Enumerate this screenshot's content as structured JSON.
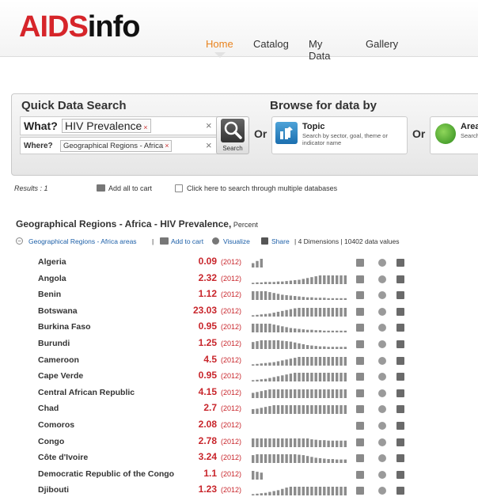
{
  "logo": {
    "part1": "AIDS",
    "part2": "info"
  },
  "nav": {
    "home": "Home",
    "catalog": "Catalog",
    "mydata": "My Data",
    "gallery": "Gallery",
    "active": "Home",
    "active_color": "#e8831e"
  },
  "quick_search": {
    "title": "Quick Data Search",
    "what_label": "What?",
    "what_value": "HIV Prevalence",
    "where_label": "Where?",
    "where_value": "Geographical Regions - Africa",
    "clear_glyph": "×",
    "tag_remove_glyph": "×",
    "search_button": "Search"
  },
  "browse": {
    "title": "Browse for data by",
    "or_label": "Or",
    "topic": {
      "title": "Topic",
      "description": "Search by sector, goal, theme or indicator name"
    },
    "area": {
      "title": "Area",
      "description": "Search by region, country or district"
    }
  },
  "results_bar": {
    "results": "Results : 1",
    "add_all": "Add all to cart",
    "multi_db": "Click here to search through multiple databases"
  },
  "dataset": {
    "title": "Geographical Regions - Africa - HIV Prevalence,",
    "unit": " Percent",
    "collapse_glyph": "−",
    "region_link": "Geographical Regions - Africa areas",
    "separator": "|",
    "add_to_cart": "Add to cart",
    "visualize": "Visualize",
    "share": "Share",
    "meta": "| 4 Dimensions | 10402 data values"
  },
  "colors": {
    "value": "#c8252b",
    "brand_red": "#d6252a",
    "link": "#1c5fa8"
  },
  "rows": [
    {
      "country": "Algeria",
      "value": "0.09",
      "year": "(2012)",
      "spark": [
        0.5,
        0.75,
        1
      ]
    },
    {
      "country": "Angola",
      "value": "2.32",
      "year": "(2012)",
      "spark": [
        0.15,
        0.2,
        0.2,
        0.25,
        0.25,
        0.25,
        0.3,
        0.3,
        0.35,
        0.4,
        0.45,
        0.5,
        0.6,
        0.7,
        0.8,
        0.9,
        1,
        1,
        1,
        1,
        1,
        1,
        1
      ]
    },
    {
      "country": "Benin",
      "value": "1.12",
      "year": "(2012)",
      "spark": [
        1,
        1,
        1,
        1,
        0.9,
        0.8,
        0.7,
        0.6,
        0.55,
        0.5,
        0.45,
        0.4,
        0.35,
        0.3,
        0.3,
        0.25,
        0.25,
        0.25,
        0.2,
        0.2,
        0.2,
        0.2,
        0.2
      ]
    },
    {
      "country": "Botswana",
      "value": "23.03",
      "year": "(2012)",
      "spark": [
        0.15,
        0.2,
        0.25,
        0.3,
        0.35,
        0.45,
        0.55,
        0.65,
        0.75,
        0.85,
        0.95,
        1,
        1,
        1,
        1,
        1,
        1,
        1,
        1,
        1,
        1,
        1,
        1
      ]
    },
    {
      "country": "Burkina Faso",
      "value": "0.95",
      "year": "(2012)",
      "spark": [
        1,
        1,
        1,
        1,
        1,
        0.9,
        0.8,
        0.7,
        0.6,
        0.5,
        0.45,
        0.4,
        0.35,
        0.3,
        0.3,
        0.25,
        0.25,
        0.2,
        0.2,
        0.2,
        0.2,
        0.2,
        0.2
      ]
    },
    {
      "country": "Burundi",
      "value": "1.25",
      "year": "(2012)",
      "spark": [
        0.8,
        0.9,
        1,
        1,
        1,
        1,
        1,
        0.95,
        0.9,
        0.85,
        0.75,
        0.65,
        0.55,
        0.45,
        0.4,
        0.35,
        0.3,
        0.3,
        0.25,
        0.25,
        0.25,
        0.25,
        0.25
      ]
    },
    {
      "country": "Cameroon",
      "value": "4.5",
      "year": "(2012)",
      "spark": [
        0.15,
        0.2,
        0.25,
        0.3,
        0.35,
        0.4,
        0.5,
        0.6,
        0.7,
        0.8,
        0.9,
        1,
        1,
        1,
        1,
        1,
        1,
        1,
        1,
        1,
        1,
        1,
        1
      ]
    },
    {
      "country": "Cape Verde",
      "value": "0.95",
      "year": "(2012)",
      "spark": [
        0.15,
        0.2,
        0.25,
        0.3,
        0.4,
        0.5,
        0.6,
        0.7,
        0.8,
        0.9,
        1,
        1,
        1,
        1,
        1,
        1,
        1,
        1,
        1,
        1,
        1,
        1,
        1
      ]
    },
    {
      "country": "Central African Republic",
      "value": "4.15",
      "year": "(2012)",
      "spark": [
        0.6,
        0.7,
        0.8,
        0.9,
        1,
        1,
        1,
        1,
        1,
        1,
        1,
        1,
        1,
        1,
        1,
        1,
        1,
        1,
        1,
        1,
        1,
        1,
        1
      ]
    },
    {
      "country": "Chad",
      "value": "2.7",
      "year": "(2012)",
      "spark": [
        0.55,
        0.6,
        0.7,
        0.8,
        0.9,
        1,
        1,
        1,
        1,
        1,
        1,
        1,
        1,
        1,
        1,
        1,
        1,
        1,
        1,
        1,
        1,
        1,
        1
      ]
    },
    {
      "country": "Comoros",
      "value": "2.08",
      "year": "(2012)",
      "spark": []
    },
    {
      "country": "Congo",
      "value": "2.78",
      "year": "(2012)",
      "spark": [
        1,
        1,
        1,
        1,
        1,
        1,
        1,
        1,
        1,
        1,
        1,
        1,
        1,
        1,
        0.9,
        0.85,
        0.8,
        0.8,
        0.75,
        0.75,
        0.75,
        0.75,
        0.75
      ]
    },
    {
      "country": "Côte d'Ivoire",
      "value": "3.24",
      "year": "(2012)",
      "spark": [
        0.9,
        1,
        1,
        1,
        1,
        1,
        1,
        1,
        1,
        1,
        1,
        0.95,
        0.9,
        0.8,
        0.7,
        0.6,
        0.55,
        0.5,
        0.45,
        0.45,
        0.4,
        0.4,
        0.4
      ]
    },
    {
      "country": "Democratic Republic of the Congo",
      "value": "1.1",
      "year": "(2012)",
      "spark": [
        1,
        0.9,
        0.8
      ]
    },
    {
      "country": "Djibouti",
      "value": "1.23",
      "year": "(2012)",
      "spark": [
        0.15,
        0.2,
        0.25,
        0.3,
        0.4,
        0.5,
        0.6,
        0.75,
        0.9,
        1,
        1,
        1,
        1,
        1,
        1,
        1,
        1,
        1,
        1,
        1,
        1,
        1,
        1
      ]
    }
  ]
}
